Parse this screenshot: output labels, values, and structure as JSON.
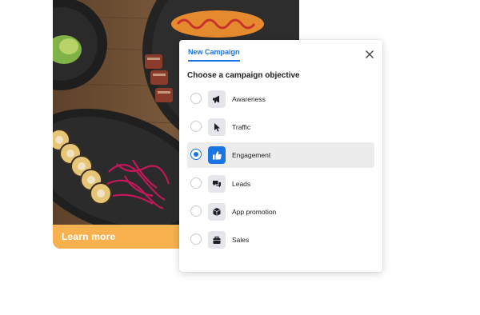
{
  "ad": {
    "cta_label": "Learn more",
    "cta_color": "#f7b14f"
  },
  "modal": {
    "tab_label": "New Campaign",
    "heading": "Choose a campaign objective",
    "accent": "#1b74e4",
    "close_icon": "close-icon",
    "options": [
      {
        "label": "Awareness",
        "icon": "megaphone-icon",
        "selected": false
      },
      {
        "label": "Traffic",
        "icon": "cursor-icon",
        "selected": false
      },
      {
        "label": "Engagement",
        "icon": "thumbs-up-icon",
        "selected": true
      },
      {
        "label": "Leads",
        "icon": "chat-bubbles-icon",
        "selected": false
      },
      {
        "label": "App promotion",
        "icon": "box-icon",
        "selected": false
      },
      {
        "label": "Sales",
        "icon": "shopping-bag-icon",
        "selected": false
      }
    ]
  }
}
